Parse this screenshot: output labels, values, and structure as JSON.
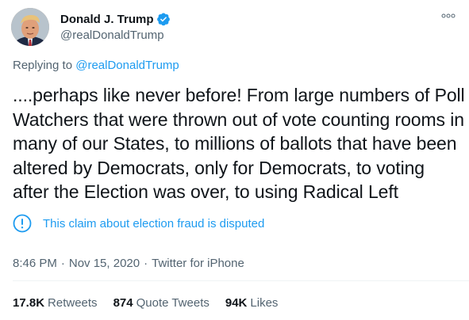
{
  "author": {
    "display_name": "Donald J. Trump",
    "handle": "@realDonaldTrump",
    "verified": true,
    "verified_color": "#1d9bf0"
  },
  "reply": {
    "prefix": "Replying to ",
    "mention": "@realDonaldTrump"
  },
  "tweet": {
    "text": "....perhaps like never before! From large numbers of Poll Watchers that were thrown out of vote counting rooms in many of our States, to millions of ballots that have been altered by Democrats, only for Democrats, to voting after the Election was over, to using Radical Left"
  },
  "label": {
    "icon": "exclamation-circle-icon",
    "text": "This claim about election fraud is disputed"
  },
  "meta": {
    "time": "8:46 PM",
    "separator": "·",
    "date": "Nov 15, 2020",
    "source": "Twitter for iPhone"
  },
  "stats": {
    "retweets_count": "17.8K",
    "retweets_label": "Retweets",
    "quotes_count": "874",
    "quotes_label": "Quote Tweets",
    "likes_count": "94K",
    "likes_label": "Likes"
  },
  "colors": {
    "accent": "#1d9bf0",
    "text": "#0f1419",
    "secondary": "#536471"
  }
}
